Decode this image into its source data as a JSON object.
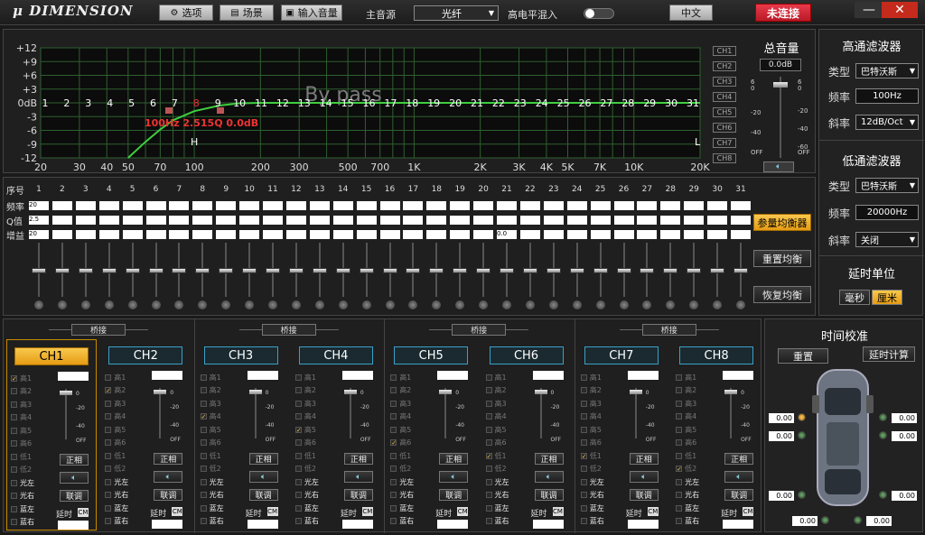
{
  "app": {
    "logo": "DIMENSION",
    "options_label": "选项",
    "scene_label": "场景",
    "input_volume_label": "输入音量",
    "main_source_label": "主音源",
    "main_source_value": "光纤",
    "high_level_mix_label": "高电平混入",
    "language_label": "中文",
    "connect_status": "未连接",
    "min_label": "—",
    "close_label": "✕"
  },
  "eq_chart": {
    "bypass_text": "By pass",
    "peq_text": "100Hz 2.515Q 0.0dB",
    "h_marker": "H",
    "l_marker": "L",
    "y_ticks": [
      "+12",
      "+9",
      "+6",
      "+3",
      "0dB",
      "-3",
      "-6",
      "-9",
      "-12"
    ],
    "x_ticks": [
      "20",
      "30",
      "40",
      "50",
      "70",
      "100",
      "200",
      "300",
      "500",
      "700",
      "1K",
      "2K",
      "3K",
      "4K",
      "5K",
      "7K",
      "10K",
      "20K"
    ],
    "band_numbers": [
      "1",
      "2",
      "3",
      "4",
      "5",
      "6",
      "7",
      "8",
      "9",
      "10",
      "11",
      "12",
      "13",
      "14",
      "15",
      "16",
      "17",
      "18",
      "19",
      "20",
      "21",
      "22",
      "23",
      "24",
      "25",
      "26",
      "27",
      "28",
      "29",
      "30",
      "31"
    ],
    "ch_labels": [
      "CH1",
      "CH2",
      "CH3",
      "CH4",
      "CH5",
      "CH6",
      "CH7",
      "CH8"
    ]
  },
  "chart_data": {
    "type": "line",
    "title": "",
    "xlabel": "",
    "ylabel": "",
    "x_scale": "log",
    "xlim": [
      20,
      20000
    ],
    "ylim": [
      -12,
      12
    ],
    "series": [
      {
        "x": [
          50,
          60,
          70,
          80,
          100,
          130,
          160,
          200,
          20000
        ],
        "y": [
          -12,
          -8.5,
          -5.8,
          -3.8,
          -1.8,
          -0.6,
          -0.1,
          0,
          0
        ]
      }
    ],
    "grid": true
  },
  "master": {
    "title": "总音量",
    "value": "0.0dB",
    "scale_left": [
      "6",
      "0",
      "-20",
      "-40",
      "OFF"
    ],
    "scale_right": [
      "6",
      "0",
      "-20",
      "-40",
      "-60",
      "OFF"
    ]
  },
  "hpf": {
    "title": "高通滤波器",
    "type_label": "类型",
    "type_value": "巴特沃斯",
    "freq_label": "频率",
    "freq_value": "100Hz",
    "slope_label": "斜率",
    "slope_value": "12dB/Oct"
  },
  "lpf": {
    "title": "低通滤波器",
    "type_label": "类型",
    "type_value": "巴特沃斯",
    "freq_label": "频率",
    "freq_value": "20000Hz",
    "slope_label": "斜率",
    "slope_value": "关闭"
  },
  "delay_unit": {
    "title": "延时单位",
    "ms_label": "毫秒",
    "cm_label": "厘米"
  },
  "band_table": {
    "seq_label": "序号",
    "freq_label": "频率",
    "q_label": "Q值",
    "gain_label": "增益",
    "gain_21": "0.0",
    "freq_1": "20",
    "q_1": "2.5",
    "gain_1": "20"
  },
  "eq_buttons": {
    "param_eq": "参量均衡器",
    "reset_eq": "重置均衡",
    "restore_eq": "恢复均衡"
  },
  "channels": {
    "bridge_label": "桥接",
    "names": [
      "CH1",
      "CH2",
      "CH3",
      "CH4",
      "CH5",
      "CH6",
      "CH7",
      "CH8"
    ],
    "sources": [
      "高1",
      "高2",
      "高3",
      "高4",
      "高5",
      "高6",
      "低1",
      "低2",
      "光左",
      "光右",
      "蓝左",
      "蓝右"
    ],
    "phase_label": "正相",
    "link_label": "联调",
    "delay_label": "延时",
    "cm_unit": "CM",
    "fader_marks": [
      "0",
      "-20",
      "-40",
      "OFF"
    ]
  },
  "time_cal": {
    "title": "时间校准",
    "reset_label": "重置",
    "calc_label": "延时计算",
    "spk_value": "0.00"
  }
}
